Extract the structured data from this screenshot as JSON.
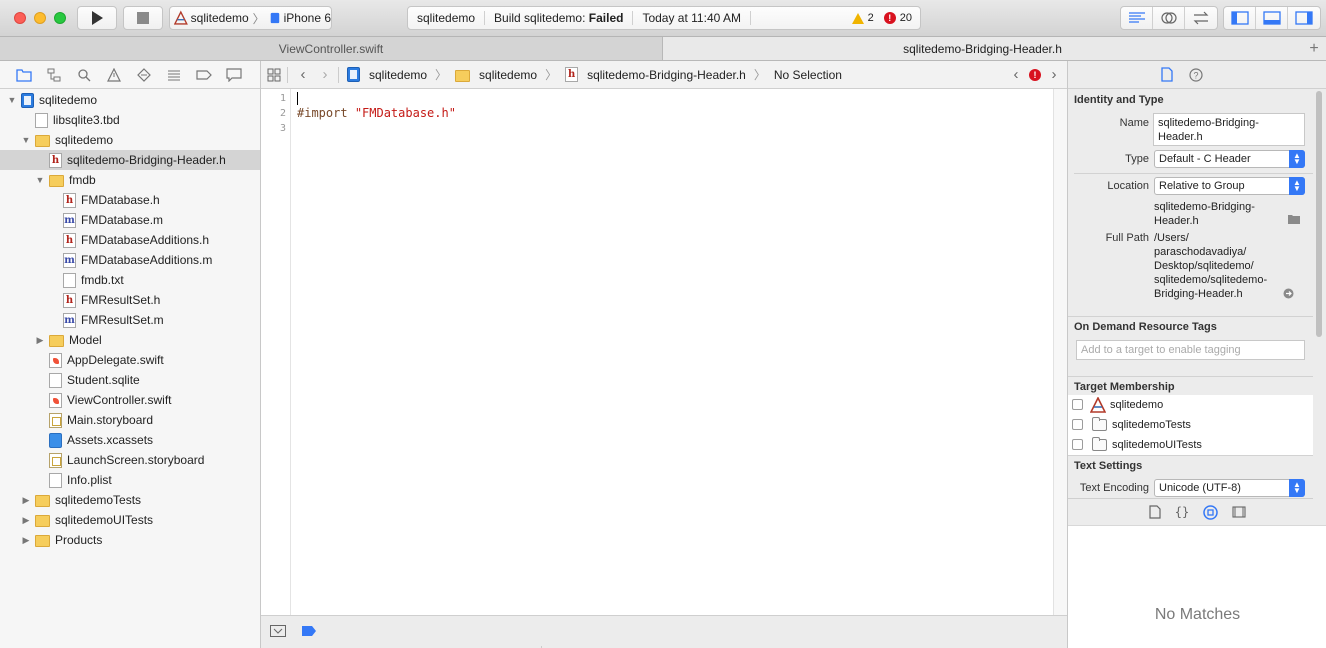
{
  "toolbar": {
    "scheme": {
      "project": "sqlitedemo",
      "device": "iPhone 6"
    },
    "status": {
      "project": "sqlitedemo",
      "build_prefix": "Build sqlitedemo:",
      "build_result": "Failed",
      "time": "Today at 11:40 AM",
      "warnings": "2",
      "errors": "20"
    }
  },
  "tabs": [
    {
      "label": "ViewController.swift",
      "active": false
    },
    {
      "label": "sqlitedemo-Bridging-Header.h",
      "active": true
    }
  ],
  "navigator": {
    "tree": [
      {
        "label": "sqlitedemo",
        "icon": "project-icon",
        "indent": 0,
        "disclosure": "open"
      },
      {
        "label": "libsqlite3.tbd",
        "icon": "file-icon",
        "indent": 1,
        "disclosure": ""
      },
      {
        "label": "sqlitedemo",
        "icon": "folder-icon",
        "indent": 1,
        "disclosure": "open"
      },
      {
        "label": "sqlitedemo-Bridging-Header.h",
        "icon": "h-file-icon",
        "indent": 2,
        "disclosure": "",
        "selected": true
      },
      {
        "label": "fmdb",
        "icon": "folder-icon",
        "indent": 2,
        "disclosure": "open"
      },
      {
        "label": "FMDatabase.h",
        "icon": "h-file-icon",
        "indent": 3,
        "disclosure": ""
      },
      {
        "label": "FMDatabase.m",
        "icon": "m-file-icon",
        "indent": 3,
        "disclosure": ""
      },
      {
        "label": "FMDatabaseAdditions.h",
        "icon": "h-file-icon",
        "indent": 3,
        "disclosure": ""
      },
      {
        "label": "FMDatabaseAdditions.m",
        "icon": "m-file-icon",
        "indent": 3,
        "disclosure": ""
      },
      {
        "label": "fmdb.txt",
        "icon": "file-icon",
        "indent": 3,
        "disclosure": ""
      },
      {
        "label": "FMResultSet.h",
        "icon": "h-file-icon",
        "indent": 3,
        "disclosure": ""
      },
      {
        "label": "FMResultSet.m",
        "icon": "m-file-icon",
        "indent": 3,
        "disclosure": ""
      },
      {
        "label": "Model",
        "icon": "folder-icon",
        "indent": 2,
        "disclosure": "closed"
      },
      {
        "label": "AppDelegate.swift",
        "icon": "swift-file-icon",
        "indent": 2,
        "disclosure": ""
      },
      {
        "label": "Student.sqlite",
        "icon": "file-icon",
        "indent": 2,
        "disclosure": ""
      },
      {
        "label": "ViewController.swift",
        "icon": "swift-file-icon",
        "indent": 2,
        "disclosure": ""
      },
      {
        "label": "Main.storyboard",
        "icon": "storyboard-icon",
        "indent": 2,
        "disclosure": ""
      },
      {
        "label": "Assets.xcassets",
        "icon": "assets-icon",
        "indent": 2,
        "disclosure": ""
      },
      {
        "label": "LaunchScreen.storyboard",
        "icon": "storyboard-icon",
        "indent": 2,
        "disclosure": ""
      },
      {
        "label": "Info.plist",
        "icon": "file-icon",
        "indent": 2,
        "disclosure": ""
      },
      {
        "label": "sqlitedemoTests",
        "icon": "folder-icon",
        "indent": 1,
        "disclosure": "closed"
      },
      {
        "label": "sqlitedemoUITests",
        "icon": "folder-icon",
        "indent": 1,
        "disclosure": "closed"
      },
      {
        "label": "Products",
        "icon": "folder-icon",
        "indent": 1,
        "disclosure": "closed"
      }
    ]
  },
  "jumpbar": {
    "crumbs": [
      "sqlitedemo",
      "sqlitedemo",
      "sqlitedemo-Bridging-Header.h",
      "No Selection"
    ]
  },
  "editor": {
    "line_numbers": [
      "1",
      "2",
      "3"
    ],
    "lines": [
      {
        "keyword": "",
        "string": ""
      },
      {
        "keyword": "#import",
        "string": "\"FMDatabase.h\""
      },
      {
        "keyword": "",
        "string": ""
      }
    ]
  },
  "inspector": {
    "identity": {
      "title": "Identity and Type",
      "name_label": "Name",
      "name_value": "sqlitedemo-Bridging-Header.h",
      "name_value_lines": [
        "sqlitedemo-Bridging-",
        "Header.h"
      ],
      "type_label": "Type",
      "type_value": "Default - C Header",
      "location_label": "Location",
      "location_value": "Relative to Group",
      "location_path": [
        "sqlitedemo-Bridging-",
        "Header.h"
      ],
      "full_path_label": "Full Path",
      "full_path": [
        "/Users/",
        "paraschodavadiya/",
        "Desktop/sqlitedemo/",
        "sqlitedemo/sqlitedemo-",
        "Bridging-Header.h"
      ]
    },
    "on_demand": {
      "title": "On Demand Resource Tags",
      "placeholder": "Add to a target to enable tagging"
    },
    "target_membership": {
      "title": "Target Membership",
      "targets": [
        {
          "label": "sqlitedemo",
          "checked": false
        },
        {
          "label": "sqlitedemoTests",
          "checked": false
        },
        {
          "label": "sqlitedemoUITests",
          "checked": false
        }
      ]
    },
    "text_settings": {
      "title": "Text Settings",
      "encoding_label": "Text Encoding",
      "encoding_value": "Unicode (UTF-8)"
    },
    "library": {
      "empty_text": "No Matches"
    }
  },
  "colors": {
    "accent": "#3478f6",
    "error": "#d8121f",
    "warning": "#f0b400",
    "string_literal": "#c41a16",
    "keyword": "#78492a"
  }
}
